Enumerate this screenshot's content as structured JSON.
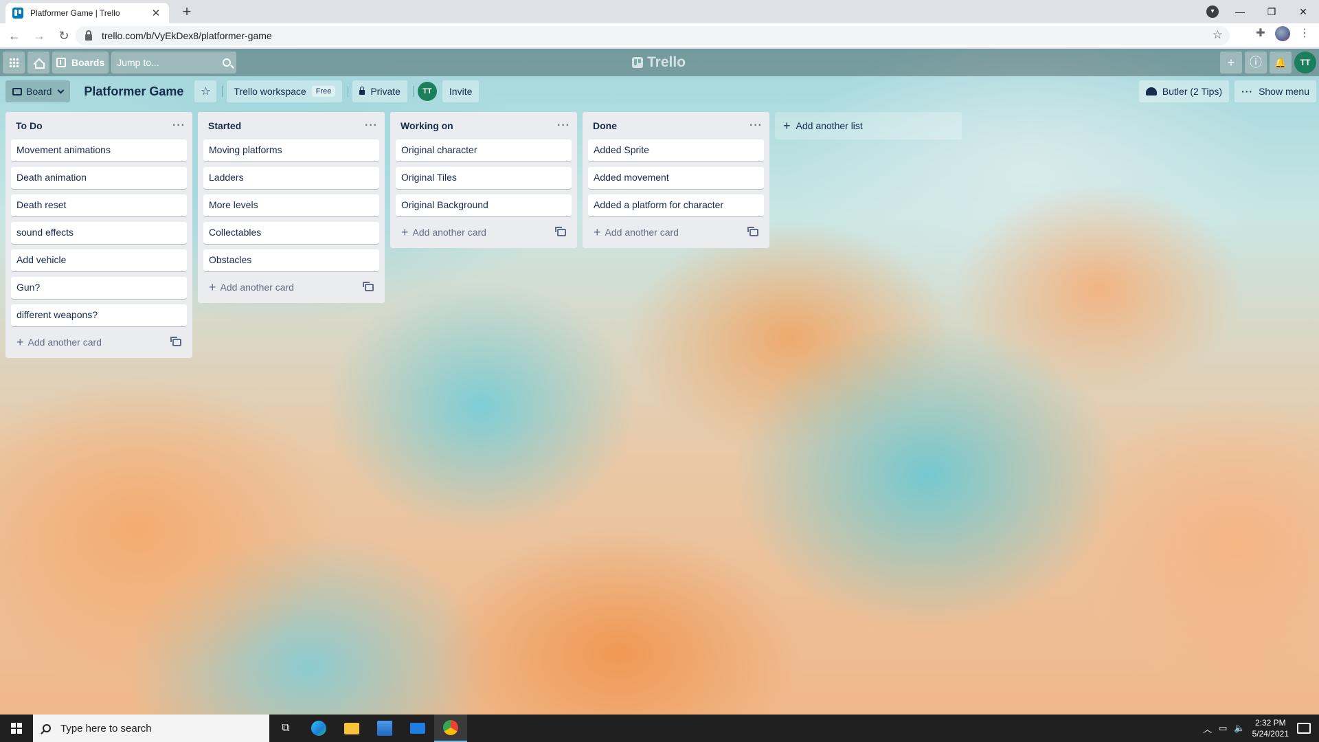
{
  "browser": {
    "tab_title": "Platformer Game | Trello",
    "tab_close": "✕",
    "new_tab": "+",
    "url": "trello.com/b/VyEkDex8/platformer-game",
    "window_controls": [
      "—",
      "❐",
      "✕"
    ]
  },
  "header": {
    "boards_label": "Boards",
    "jump_placeholder": "Jump to...",
    "logo_text": "Trello",
    "avatar_initials": "TT",
    "buttons": {
      "create": "+",
      "info": "ⓘ",
      "notifications": "🔔"
    }
  },
  "board_header": {
    "view_label": "Board",
    "title": "Platformer Game",
    "workspace_label": "Trello workspace",
    "workspace_badge": "Free",
    "visibility_label": "Private",
    "member_initials": "TT",
    "invite_label": "Invite",
    "butler_label": "Butler (2 Tips)",
    "show_menu_label": "Show menu"
  },
  "lists": [
    {
      "title": "To Do",
      "cards": [
        "Movement animations",
        "Death animation",
        "Death reset",
        "sound effects",
        "Add vehicle",
        "Gun?",
        "different weapons?"
      ],
      "add_card": "Add another card"
    },
    {
      "title": "Started",
      "cards": [
        "Moving platforms",
        "Ladders",
        "More levels",
        "Collectables",
        "Obstacles"
      ],
      "add_card": "Add another card"
    },
    {
      "title": "Working on",
      "cards": [
        "Original character",
        "Original Tiles",
        "Original Background"
      ],
      "add_card": "Add another card"
    },
    {
      "title": "Done",
      "cards": [
        "Added Sprite",
        "Added movement",
        "Added a platform for character"
      ],
      "add_card": "Add another card"
    }
  ],
  "add_list_label": "Add another list",
  "taskbar": {
    "search_placeholder": "Type here to search",
    "time": "2:32 PM",
    "date": "5/24/2021"
  },
  "colors": {
    "trello_blue": "#0079bf",
    "avatar_green": "#1a7f5a",
    "list_bg": "#ebecf0"
  }
}
